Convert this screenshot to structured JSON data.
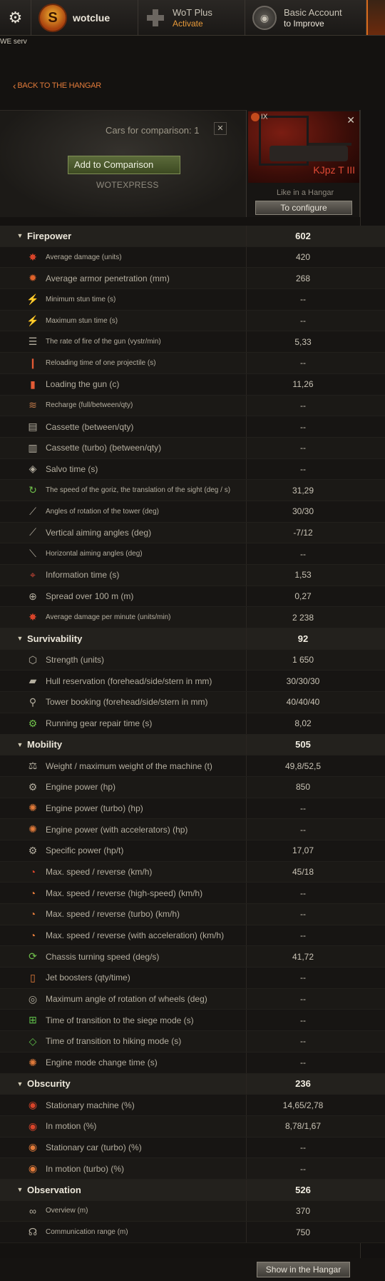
{
  "topbar": {
    "username": "wotclue",
    "badge_letter": "S",
    "wot_plus": {
      "title": "WoT Plus",
      "action": "Activate"
    },
    "account": {
      "title": "Basic Account",
      "action": "to Improve"
    }
  },
  "server_text": "WE serv",
  "back_label": "BACK TO THE HANGAR",
  "comparison": {
    "count_label": "Cars for comparison: 1",
    "add_button": "Add to Comparison",
    "name": "WOTEXPRESS"
  },
  "tank": {
    "tier": "IX",
    "name": "KJpz T III",
    "hangar_note": "Like in a Hangar",
    "configure_button": "To configure"
  },
  "sections": [
    {
      "name": "Firepower",
      "value": "602",
      "rows": [
        {
          "label": "Average damage (units)",
          "value": "420",
          "icon": "damage-icon",
          "small": true
        },
        {
          "label": "Average armor penetration (mm)",
          "value": "268",
          "icon": "penetration-icon"
        },
        {
          "label": "Minimum stun time (s)",
          "value": "--",
          "icon": "stun-icon",
          "small": true
        },
        {
          "label": "Maximum stun time (s)",
          "value": "--",
          "icon": "stun-icon",
          "small": true
        },
        {
          "label": "The rate of fire of the gun (vystr/min)",
          "value": "5,33",
          "icon": "fire-rate-icon",
          "small": true
        },
        {
          "label": "Reloading time of one projectile (s)",
          "value": "--",
          "icon": "shell-reload-icon",
          "small": true
        },
        {
          "label": "Loading the gun (c)",
          "value": "11,26",
          "icon": "shell-icon"
        },
        {
          "label": "Recharge (full/between/qty)",
          "value": "--",
          "icon": "recharge-icon",
          "small": true
        },
        {
          "label": "Cassette (between/qty)",
          "value": "--",
          "icon": "cassette-icon"
        },
        {
          "label": "Cassette (turbo) (between/qty)",
          "value": "--",
          "icon": "cassette-turbo-icon"
        },
        {
          "label": "Salvo time (s)",
          "value": "--",
          "icon": "salvo-icon"
        },
        {
          "label": "The speed of the goriz, the translation of the sight (deg / s)",
          "value": "31,29",
          "icon": "traverse-icon",
          "small": true
        },
        {
          "label": "Angles of rotation of the tower (deg)",
          "value": "30/30",
          "icon": "turret-angle-icon",
          "small": true
        },
        {
          "label": "Vertical aiming angles (deg)",
          "value": "-7/12",
          "icon": "vertical-angle-icon"
        },
        {
          "label": "Horizontal aiming angles (deg)",
          "value": "--",
          "icon": "horizontal-angle-icon",
          "small": true
        },
        {
          "label": "Information time (s)",
          "value": "1,53",
          "icon": "aim-time-icon"
        },
        {
          "label": "Spread over 100 m (m)",
          "value": "0,27",
          "icon": "crosshair-icon"
        },
        {
          "label": "Average damage per minute (units/min)",
          "value": "2 238",
          "icon": "dpm-icon",
          "small": true
        }
      ]
    },
    {
      "name": "Survivability",
      "value": "92",
      "rows": [
        {
          "label": "Strength (units)",
          "value": "1 650",
          "icon": "hp-cube-icon"
        },
        {
          "label": "Hull reservation (forehead/side/stern in mm)",
          "value": "30/30/30",
          "icon": "hull-armor-icon"
        },
        {
          "label": "Tower booking (forehead/side/stern in mm)",
          "value": "40/40/40",
          "icon": "turret-armor-icon"
        },
        {
          "label": "Running gear repair time (s)",
          "value": "8,02",
          "icon": "repair-icon"
        }
      ]
    },
    {
      "name": "Mobility",
      "value": "505",
      "rows": [
        {
          "label": "Weight / maximum weight of the machine (t)",
          "value": "49,8/52,5",
          "icon": "weight-icon"
        },
        {
          "label": "Engine power (hp)",
          "value": "850",
          "icon": "engine-icon"
        },
        {
          "label": "Engine power (turbo) (hp)",
          "value": "--",
          "icon": "engine-turbo-icon"
        },
        {
          "label": "Engine power (with accelerators) (hp)",
          "value": "--",
          "icon": "engine-boost-icon"
        },
        {
          "label": "Specific power (hp/t)",
          "value": "17,07",
          "icon": "specific-power-icon"
        },
        {
          "label": "Max. speed / reverse (km/h)",
          "value": "45/18",
          "icon": "speed-icon"
        },
        {
          "label": "Max. speed / reverse (high-speed) (km/h)",
          "value": "--",
          "icon": "speed-fast-icon"
        },
        {
          "label": "Max. speed / reverse (turbo) (km/h)",
          "value": "--",
          "icon": "speed-turbo-icon"
        },
        {
          "label": "Max. speed / reverse (with acceleration) (km/h)",
          "value": "--",
          "icon": "speed-boost-icon"
        },
        {
          "label": "Chassis turning speed (deg/s)",
          "value": "41,72",
          "icon": "chassis-icon"
        },
        {
          "label": "Jet boosters (qty/time)",
          "value": "--",
          "icon": "jet-icon"
        },
        {
          "label": "Maximum angle of rotation of wheels (deg)",
          "value": "--",
          "icon": "wheel-icon"
        },
        {
          "label": "Time of transition to the siege mode (s)",
          "value": "--",
          "icon": "siege-icon"
        },
        {
          "label": "Time of transition to hiking mode (s)",
          "value": "--",
          "icon": "hiking-icon"
        },
        {
          "label": "Engine mode change time (s)",
          "value": "--",
          "icon": "engine-mode-icon"
        }
      ]
    },
    {
      "name": "Obscurity",
      "value": "236",
      "rows": [
        {
          "label": "Stationary machine (%)",
          "value": "14,65/2,78",
          "icon": "camo-still-icon"
        },
        {
          "label": "In motion (%)",
          "value": "8,78/1,67",
          "icon": "camo-move-icon"
        },
        {
          "label": "Stationary car (turbo) (%)",
          "value": "--",
          "icon": "camo-still-turbo-icon"
        },
        {
          "label": "In motion (turbo) (%)",
          "value": "--",
          "icon": "camo-move-turbo-icon"
        }
      ]
    },
    {
      "name": "Observation",
      "value": "526",
      "rows": [
        {
          "label": "Overview (m)",
          "value": "370",
          "icon": "binoculars-icon",
          "small": true
        },
        {
          "label": "Communication range (m)",
          "value": "750",
          "icon": "radio-icon",
          "small": true
        }
      ]
    }
  ],
  "footer_button": "Show in the Hangar",
  "colors": {
    "accent": "#e07a3a",
    "value_bold": "#f2eee2",
    "tank_name": "#e04a35"
  }
}
